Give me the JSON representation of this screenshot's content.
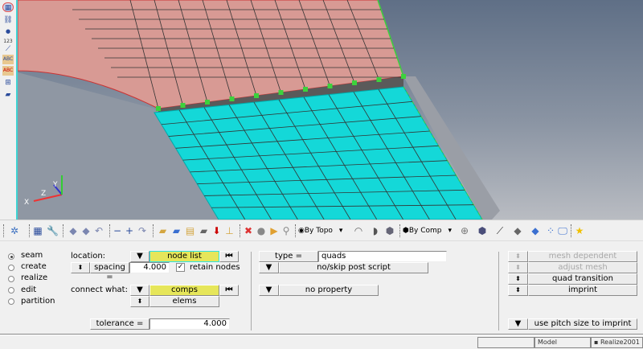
{
  "viewport": {
    "axis_labels": {
      "x": "X",
      "y": "Y",
      "z": "Z"
    },
    "colors": {
      "shell_top": "#d89a94",
      "shell_bottom": "#14d8d8",
      "seam_nodes": "#3cd23c",
      "seam_wall": "#5a5a5a"
    }
  },
  "left_toolbar": {
    "icons": [
      "mesh-display-icon",
      "links-icon",
      "numbers-icon",
      "measure-icon",
      "component-labels-icon",
      "load-labels-icon",
      "element-labels-icon",
      "plane-icon"
    ],
    "numbers_label": "123",
    "abc_label": "ABC"
  },
  "toolbar": {
    "topo_select": "By Topo",
    "comp_select": "By Comp"
  },
  "panel": {
    "radios": [
      {
        "label": "seam",
        "selected": true
      },
      {
        "label": "create",
        "selected": false
      },
      {
        "label": "realize",
        "selected": false
      },
      {
        "label": "edit",
        "selected": false
      },
      {
        "label": "partition",
        "selected": false
      }
    ],
    "location_label": "location:",
    "location_value": "node list",
    "spacing_label": "spacing =",
    "spacing_value": "4.000",
    "retain_nodes_label": "retain nodes",
    "retain_nodes_checked": true,
    "connect_what_label": "connect what:",
    "connect_value": "comps",
    "connect_type": "elems",
    "tolerance_label": "tolerance =",
    "tolerance_value": "4.000",
    "type_label": "type =",
    "type_value": "quads",
    "post_script": "no/skip post script",
    "property": "no property",
    "mesh_dependent": "mesh dependent",
    "adjust_mesh": "adjust mesh",
    "quad_transition": "quad transition",
    "imprint": "imprint",
    "pitch": "use pitch size to imprint"
  },
  "status_bar": {
    "model": "Model",
    "name": "Realize2001"
  }
}
